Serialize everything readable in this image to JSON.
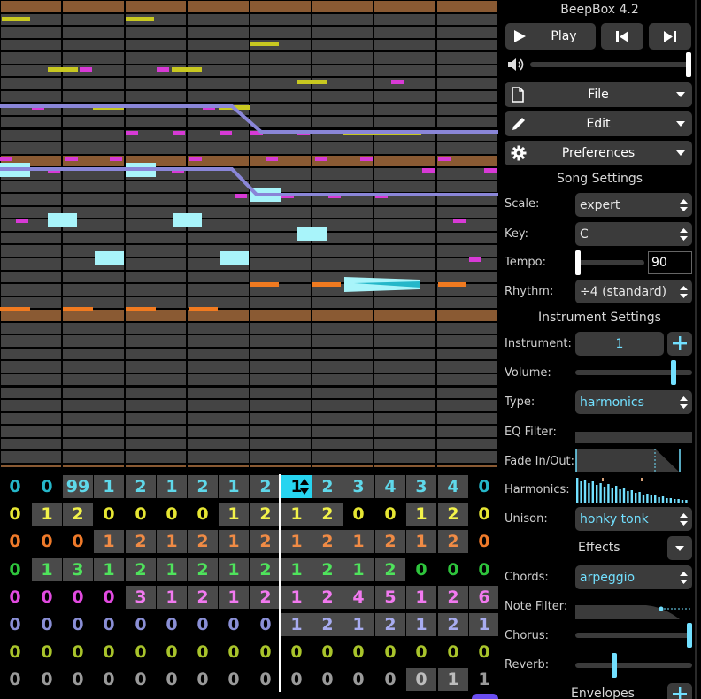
{
  "app": {
    "title": "BeepBox 4.2"
  },
  "transport": {
    "play_label": "Play"
  },
  "menus": {
    "file_label": "File",
    "edit_label": "Edit",
    "preferences_label": "Preferences"
  },
  "song_settings": {
    "heading": "Song Settings",
    "scale_label": "Scale:",
    "scale_value": "expert",
    "key_label": "Key:",
    "key_value": "C",
    "tempo_label": "Tempo:",
    "tempo_value": "90",
    "rhythm_label": "Rhythm:",
    "rhythm_value": "÷4 (standard)"
  },
  "instrument_settings": {
    "heading": "Instrument Settings",
    "instrument_label": "Instrument:",
    "instrument_value": "1",
    "volume_label": "Volume:",
    "type_label": "Type:",
    "type_value": "harmonics",
    "eq_filter_label": "EQ Filter:",
    "fade_label": "Fade In/Out:",
    "harmonics_label": "Harmonics:",
    "unison_label": "Unison:",
    "unison_value": "honky tonk",
    "effects_label": "Effects",
    "chords_label": "Chords:",
    "chords_value": "arpeggio",
    "note_filter_label": "Note Filter:",
    "chorus_label": "Chorus:",
    "reverb_label": "Reverb:",
    "envelopes_label": "Envelopes"
  },
  "colors": {
    "channel_colors": [
      "#25b7c9",
      "#e6e633",
      "#ef7a2a",
      "#2ec43c",
      "#e24ae0",
      "#8a8fd6",
      "#a9c42b",
      "#9a9a9a"
    ],
    "accent": "#72e0ff",
    "grid_cell": "#444444",
    "octave_row": "#8a5a33"
  },
  "pattern_grid": [
    [
      "0",
      "0",
      "99",
      "1",
      "2",
      "1",
      "2",
      "1",
      "2",
      "1",
      "2",
      "3",
      "4",
      "3",
      "4",
      "0"
    ],
    [
      "0",
      "1",
      "2",
      "0",
      "0",
      "0",
      "0",
      "1",
      "2",
      "1",
      "2",
      "0",
      "0",
      "1",
      "2",
      "0"
    ],
    [
      "0",
      "0",
      "0",
      "1",
      "2",
      "1",
      "2",
      "1",
      "2",
      "1",
      "2",
      "1",
      "2",
      "1",
      "2",
      "0"
    ],
    [
      "0",
      "1",
      "3",
      "1",
      "2",
      "1",
      "2",
      "1",
      "2",
      "1",
      "2",
      "1",
      "2",
      "0",
      "0",
      "0"
    ],
    [
      "0",
      "0",
      "0",
      "0",
      "3",
      "1",
      "2",
      "1",
      "2",
      "1",
      "2",
      "4",
      "5",
      "1",
      "2",
      "6"
    ],
    [
      "0",
      "0",
      "0",
      "0",
      "0",
      "0",
      "0",
      "0",
      "0",
      "1",
      "2",
      "1",
      "2",
      "1",
      "2",
      "1"
    ],
    [
      "0",
      "0",
      "0",
      "0",
      "0",
      "0",
      "0",
      "0",
      "0",
      "0",
      "0",
      "0",
      "0",
      "0",
      "0",
      "0"
    ],
    [
      "0",
      "0",
      "0",
      "0",
      "0",
      "0",
      "0",
      "0",
      "0",
      "0",
      "0",
      "0",
      "0",
      "0",
      "1",
      "1"
    ]
  ],
  "pattern_filled": [
    [
      0,
      0,
      1,
      1,
      1,
      1,
      1,
      1,
      1,
      1,
      1,
      1,
      1,
      1,
      1,
      0
    ],
    [
      0,
      1,
      1,
      0,
      0,
      0,
      0,
      1,
      1,
      1,
      1,
      0,
      0,
      1,
      1,
      0
    ],
    [
      0,
      0,
      0,
      1,
      1,
      1,
      1,
      1,
      1,
      1,
      1,
      1,
      1,
      1,
      1,
      0
    ],
    [
      0,
      1,
      1,
      1,
      1,
      1,
      1,
      1,
      1,
      1,
      1,
      1,
      1,
      0,
      0,
      0
    ],
    [
      0,
      0,
      0,
      0,
      1,
      1,
      1,
      1,
      1,
      1,
      1,
      1,
      1,
      1,
      1,
      1
    ],
    [
      0,
      0,
      0,
      0,
      0,
      0,
      0,
      0,
      0,
      1,
      1,
      1,
      1,
      1,
      1,
      1
    ],
    [
      0,
      0,
      0,
      0,
      0,
      0,
      0,
      0,
      0,
      0,
      0,
      0,
      0,
      0,
      0,
      0
    ],
    [
      0,
      0,
      0,
      0,
      0,
      0,
      0,
      0,
      0,
      0,
      0,
      0,
      0,
      1,
      1,
      0
    ]
  ],
  "icons": [
    "play-icon",
    "skip-back-icon",
    "skip-forward-icon",
    "volume-icon",
    "file-icon",
    "edit-pencil-icon",
    "gear-icon",
    "chevron-down-icon",
    "plus-icon",
    "up-down-icon"
  ]
}
